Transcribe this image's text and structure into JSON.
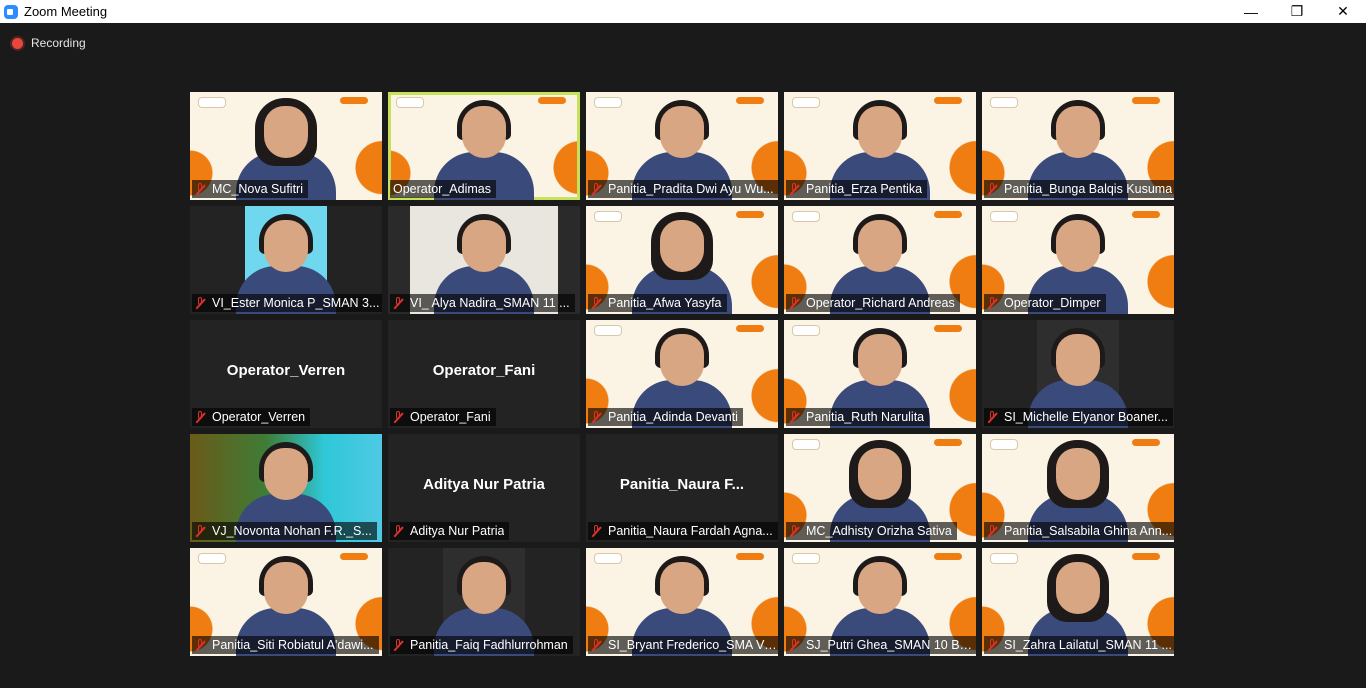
{
  "window": {
    "title": "Zoom Meeting",
    "minimize_glyph": "—",
    "restore_glyph": "❐",
    "close_glyph": "✕"
  },
  "recording": {
    "label": "Recording",
    "dot_color": "#e8453c"
  },
  "colors": {
    "active_speaker_border": "#c7e25a",
    "vb_orange": "#ef7d12",
    "vb_cream": "#fbf4e4",
    "muted_icon": "#e0302a"
  },
  "participants": [
    {
      "name": "MC_Nova Sufitri",
      "muted": true,
      "video": "virtual-bg"
    },
    {
      "name": "Operator_Adimas",
      "muted": false,
      "video": "virtual-bg",
      "active": true
    },
    {
      "name": "Panitia_Pradita Dwi Ayu Wu...",
      "muted": true,
      "video": "virtual-bg"
    },
    {
      "name": "Panitia_Erza Pentika",
      "muted": true,
      "video": "virtual-bg"
    },
    {
      "name": "Panitia_Bunga Balqis Kusuma",
      "muted": true,
      "video": "virtual-bg"
    },
    {
      "name": "VI_Ester Monica P_SMAN 3...",
      "muted": true,
      "video": "camera"
    },
    {
      "name": "VI_ Alya Nadira_SMAN 11 ...",
      "muted": true,
      "video": "camera"
    },
    {
      "name": "Panitia_Afwa Yasyfa",
      "muted": true,
      "video": "virtual-bg"
    },
    {
      "name": "Operator_Richard Andreas",
      "muted": true,
      "video": "virtual-bg"
    },
    {
      "name": "Operator_Dimper",
      "muted": true,
      "video": "virtual-bg"
    },
    {
      "name": "Operator_Verren",
      "muted": true,
      "video": "off",
      "display_name": "Operator_Verren"
    },
    {
      "name": "Operator_Fani",
      "muted": true,
      "video": "off",
      "display_name": "Operator_Fani"
    },
    {
      "name": "Panitia_Adinda Devanti",
      "muted": true,
      "video": "virtual-bg"
    },
    {
      "name": "Panitia_Ruth Narulita",
      "muted": true,
      "video": "virtual-bg"
    },
    {
      "name": "SI_Michelle Elyanor Boaner...",
      "muted": true,
      "video": "camera"
    },
    {
      "name": "VJ_Novonta Nohan F.R._S...",
      "muted": true,
      "video": "camera"
    },
    {
      "name": "Aditya Nur Patria",
      "muted": true,
      "video": "off",
      "display_name": "Aditya Nur Patria"
    },
    {
      "name": "Panitia_Naura Fardah Agna...",
      "muted": true,
      "video": "off",
      "display_name": "Panitia_Naura  F..."
    },
    {
      "name": "MC_Adhisty Orizha Sativa",
      "muted": true,
      "video": "virtual-bg"
    },
    {
      "name": "Panitia_Salsabila Ghina Ann...",
      "muted": true,
      "video": "virtual-bg"
    },
    {
      "name": "Panitia_Siti Robiatul A'dawi...",
      "muted": true,
      "video": "virtual-bg"
    },
    {
      "name": "Panitia_Faiq Fadhlurrohman",
      "muted": true,
      "video": "camera"
    },
    {
      "name": "SI_Bryant Frederico_SMA Vi...",
      "muted": true,
      "video": "virtual-bg"
    },
    {
      "name": "SJ_Putri Ghea_SMAN 10 Be...",
      "muted": true,
      "video": "virtual-bg"
    },
    {
      "name": "SI_Zahra Lailatul_SMAN 11 ...",
      "muted": true,
      "video": "virtual-bg"
    }
  ]
}
